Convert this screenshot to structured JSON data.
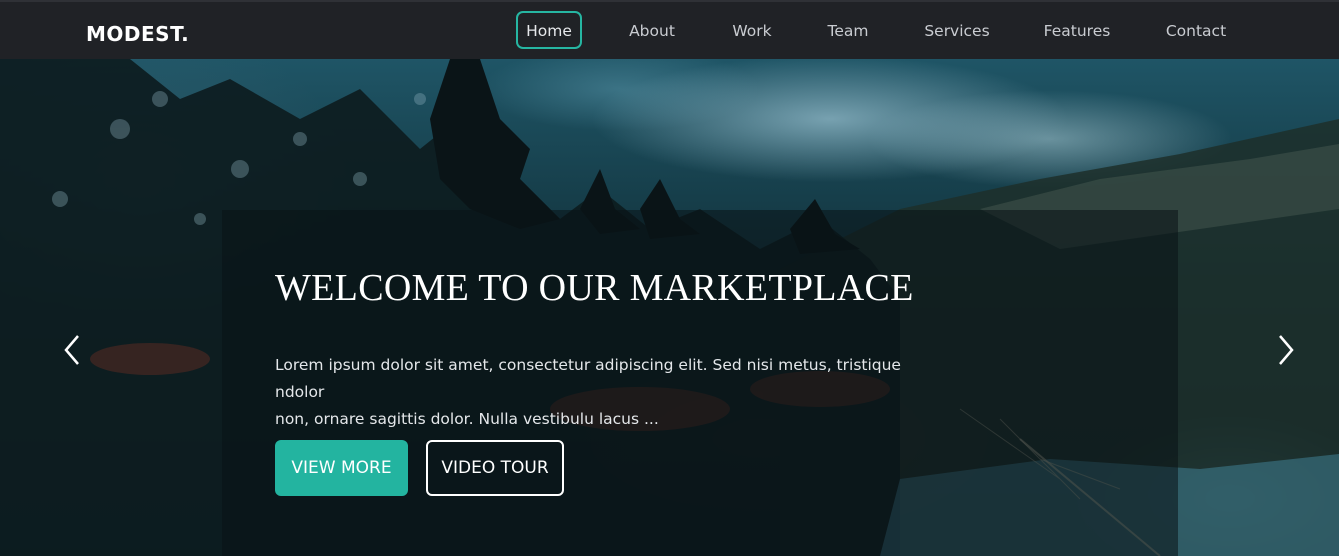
{
  "brand": {
    "logo_text": "MODEST."
  },
  "nav": {
    "items": [
      {
        "label": "Home",
        "active": true
      },
      {
        "label": "About"
      },
      {
        "label": "Work"
      },
      {
        "label": "Team"
      },
      {
        "label": "Services"
      },
      {
        "label": "Features"
      },
      {
        "label": "Contact"
      }
    ]
  },
  "hero": {
    "title": "WELCOME TO OUR MARKETPLACE",
    "body_line1": "Lorem ipsum dolor sit amet, consectetur adipiscing elit. Sed nisi metus, tristique ndolor",
    "body_line2": "non, ornare sagittis dolor. Nulla vestibulu lacus ...",
    "primary_button": "VIEW MORE",
    "secondary_button": "VIDEO TOUR"
  },
  "carousel": {
    "prev_icon": "chevron-left-icon",
    "next_icon": "chevron-right-icon"
  },
  "colors": {
    "accent": "#23b4a0",
    "nav_bg": "#202226",
    "text": "#ffffff"
  }
}
